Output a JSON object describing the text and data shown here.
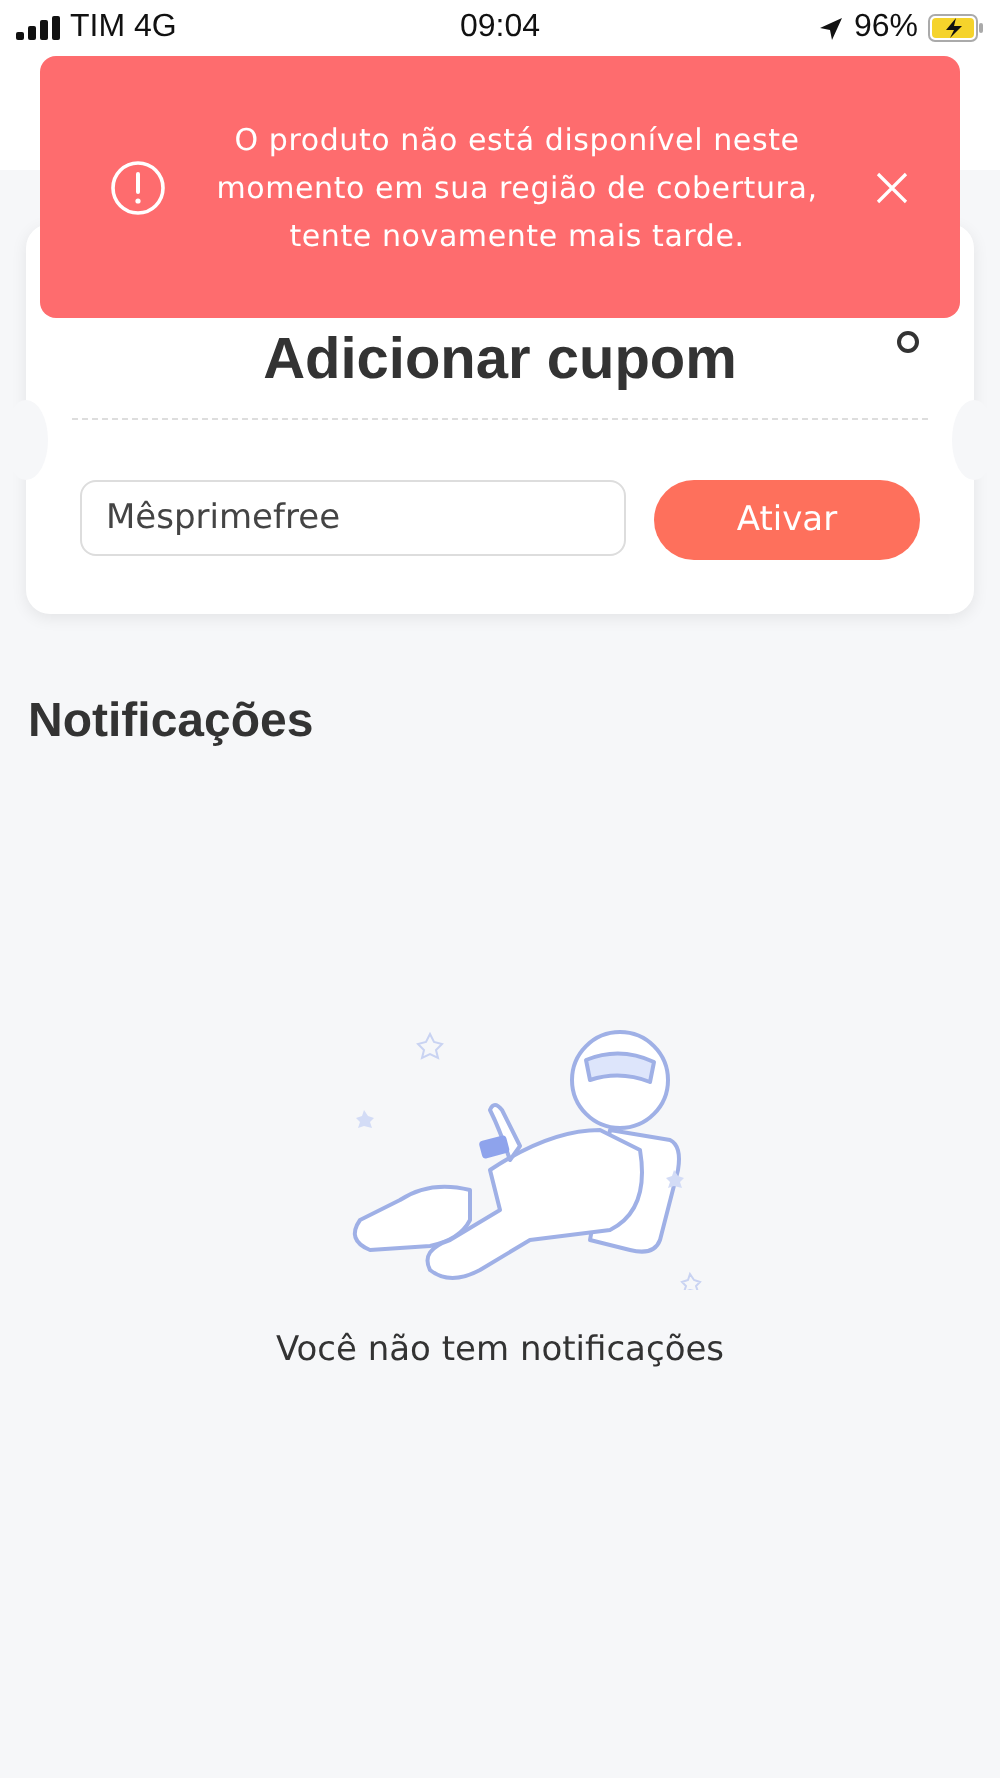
{
  "status_bar": {
    "carrier": "TIM 4G",
    "time": "09:04",
    "battery": "96%"
  },
  "toast": {
    "message": "O produto não está disponível neste momento em sua região de cobertura, tente novamente mais tarde."
  },
  "coupon": {
    "title": "Adicionar cupom",
    "value": "Mêsprimefree",
    "button": "Ativar"
  },
  "notifications": {
    "title": "Notificações",
    "empty_text": "Você não tem notificações"
  }
}
